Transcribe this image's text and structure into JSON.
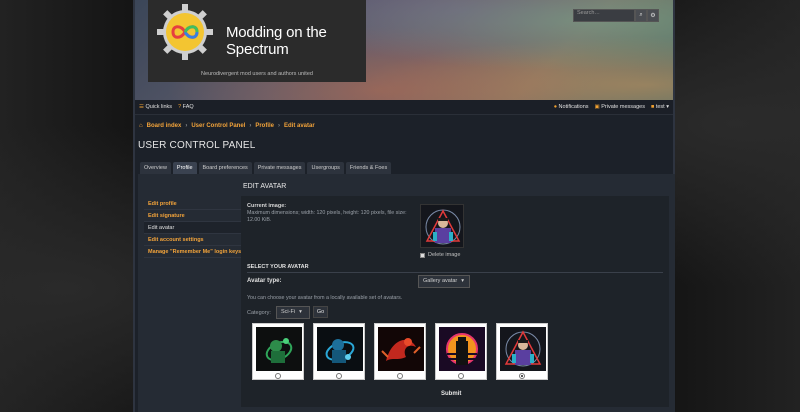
{
  "header": {
    "site_title": "Modding on the Spectrum",
    "site_description": "Neurodivergent mod users and authors united",
    "search_placeholder": "Search…",
    "search_icon": "search-icon",
    "settings_icon": "gear-icon"
  },
  "navbar": {
    "quick_links": "Quick links",
    "faq": "FAQ",
    "notifications": "Notifications",
    "private_messages": "Private messages",
    "username": "test"
  },
  "breadcrumb": [
    "Board index",
    "User Control Panel",
    "Profile",
    "Edit avatar"
  ],
  "page_title": "USER CONTROL PANEL",
  "tabs": [
    "Overview",
    "Profile",
    "Board preferences",
    "Private messages",
    "Usergroups",
    "Friends & Foes"
  ],
  "active_tab": "Profile",
  "sidebar": [
    "Edit profile",
    "Edit signature",
    "Edit avatar",
    "Edit account settings",
    "Manage \"Remember Me\" login keys"
  ],
  "content": {
    "title": "EDIT AVATAR",
    "current_image_label": "Current image:",
    "current_image_desc": "Maximum dimensions; width: 120 pixels, height: 120 pixels, file size: 12.00 KiB.",
    "delete_label": "Delete image",
    "select_heading": "SELECT YOUR AVATAR",
    "avatar_type_label": "Avatar type:",
    "avatar_type_value": "Gallery avatar",
    "hint": "You can choose your avatar from a locally available set of avatars.",
    "category_label": "Category:",
    "category_value": "Sci-Fi",
    "go_label": "Go",
    "submit_label": "Submit"
  },
  "gallery_selected_index": 4,
  "colors": {
    "accent": "#f2a33a",
    "panel": "#252b34",
    "page_bg": "#1c2129"
  }
}
